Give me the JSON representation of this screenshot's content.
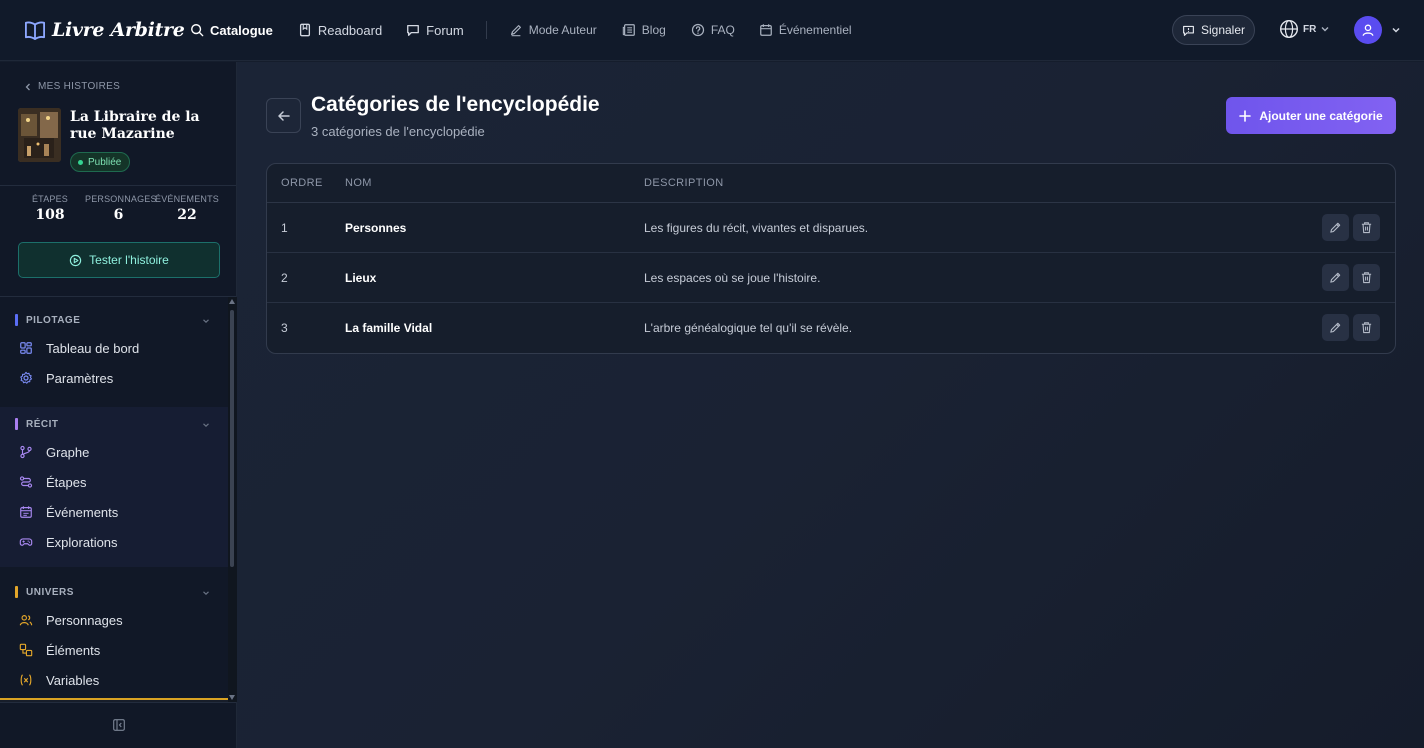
{
  "app": {
    "brand": "Livre Arbitre"
  },
  "colors": {
    "accent": "#7b5cf0",
    "success": "#35d492",
    "teal": "#8ff0de",
    "bg": "#151d2c"
  },
  "nav": {
    "items": [
      {
        "label": "Catalogue",
        "icon": "search-icon"
      },
      {
        "label": "Readboard",
        "icon": "bookmark-icon"
      },
      {
        "label": "Forum",
        "icon": "chat-icon"
      }
    ],
    "secondary": [
      {
        "label": "Mode Auteur",
        "icon": "pen-icon"
      },
      {
        "label": "Blog",
        "icon": "newspaper-icon"
      },
      {
        "label": "FAQ",
        "icon": "help-icon"
      },
      {
        "label": "Événementiel",
        "icon": "calendar-icon"
      }
    ],
    "report_label": "Signaler",
    "language": "FR"
  },
  "sidebar": {
    "back_label": "MES HISTOIRES",
    "story_title": "La Libraire de la rue Mazarine",
    "status": "Publiée",
    "stats": [
      {
        "label": "ÉTAPES",
        "value": "108"
      },
      {
        "label": "PERSONNAGES",
        "value": "6"
      },
      {
        "label": "ÉVÉNEMENTS",
        "value": "22"
      }
    ],
    "test_label": "Tester l'histoire",
    "sections": [
      {
        "title": "PILOTAGE",
        "color": "#5b6ef5",
        "items": [
          {
            "label": "Tableau de bord",
            "icon": "dashboard-icon"
          },
          {
            "label": "Paramètres",
            "icon": "settings-icon"
          }
        ]
      },
      {
        "title": "RÉCIT",
        "color": "#a97ef0",
        "items": [
          {
            "label": "Graphe",
            "icon": "graph-icon"
          },
          {
            "label": "Étapes",
            "icon": "steps-icon"
          },
          {
            "label": "Événements",
            "icon": "calendar-icon"
          },
          {
            "label": "Explorations",
            "icon": "gamepad-icon"
          }
        ]
      },
      {
        "title": "UNIVERS",
        "color": "#e3a62a",
        "items": [
          {
            "label": "Personnages",
            "icon": "users-icon"
          },
          {
            "label": "Éléments",
            "icon": "shapes-icon"
          },
          {
            "label": "Variables",
            "icon": "variable-icon"
          }
        ]
      }
    ]
  },
  "main": {
    "title": "Catégories de l'encyclopédie",
    "subtitle": "3 catégories de l'encyclopédie",
    "add_label": "Ajouter une catégorie",
    "columns": {
      "order": "ORDRE",
      "name": "NOM",
      "description": "DESCRIPTION"
    },
    "rows": [
      {
        "order": "1",
        "name": "Personnes",
        "description": "Les figures du récit, vivantes et disparues."
      },
      {
        "order": "2",
        "name": "Lieux",
        "description": "Les espaces où se joue l'histoire."
      },
      {
        "order": "3",
        "name": "La famille Vidal",
        "description": "L'arbre généalogique tel qu'il se révèle."
      }
    ]
  }
}
